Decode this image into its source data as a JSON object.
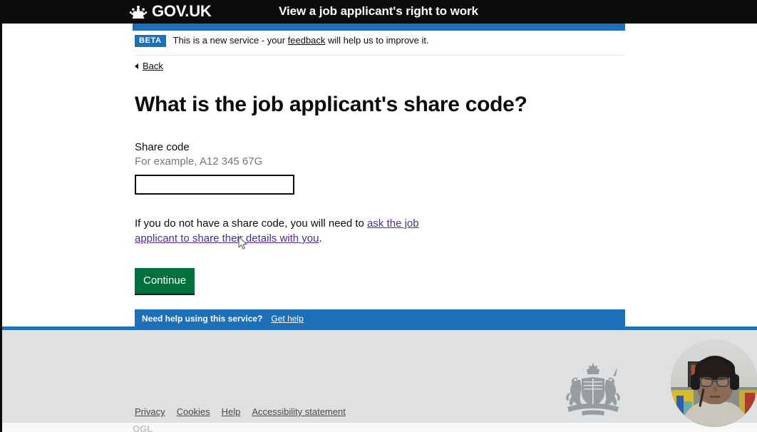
{
  "header": {
    "logo_text": "GOV.UK",
    "crown_icon": "crown-icon",
    "service_title": "View a job applicant's right to work"
  },
  "phase_banner": {
    "tag": "BETA",
    "text_before": "This is a new service - your ",
    "link": "feedback",
    "text_after": " will help us to improve it."
  },
  "back_link": {
    "label": "Back",
    "icon": "back-arrow-icon"
  },
  "main": {
    "heading": "What is the job applicant's share code?",
    "field": {
      "label": "Share code",
      "hint": "For example, A12 345 67G",
      "value": "",
      "placeholder": ""
    },
    "paragraph": {
      "text_before": "If you do not have a share code, you will need to ",
      "link": "ask the job applicant to share their details with you",
      "text_after": "."
    },
    "continue_button": "Continue"
  },
  "help_bar": {
    "label": "Need help using this service?",
    "link": "Get help"
  },
  "footer": {
    "links": [
      "Privacy",
      "Cookies",
      "Help",
      "Accessibility statement"
    ],
    "crest_icon": "royal-coat-of-arms-icon",
    "clipped_text": "OGL"
  },
  "overlay": {
    "webcam": "webcam-presenter-video",
    "cursor": "mouse-pointer-icon"
  },
  "colors": {
    "header_black": "#0b0c0c",
    "govuk_blue": "#1d70b8",
    "govuk_green": "#00703c",
    "link_visited_purple": "#4c2c92",
    "footer_grey": "#dee0e2",
    "hint_grey": "#6f777b"
  }
}
